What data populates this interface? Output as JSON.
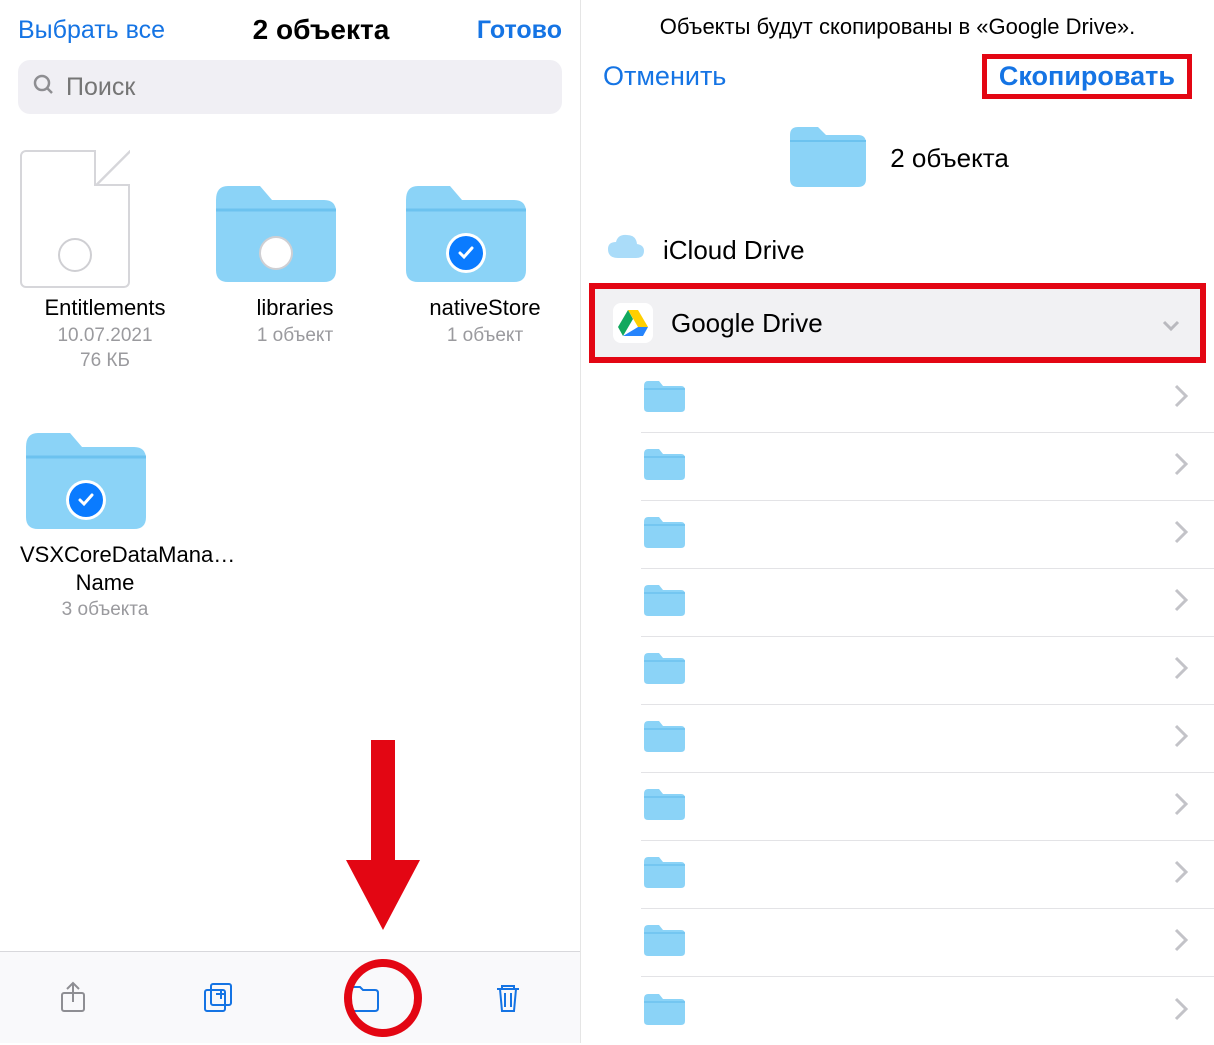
{
  "left": {
    "select_all": "Выбрать все",
    "title": "2 объекта",
    "done": "Готово",
    "search_placeholder": "Поиск",
    "items": [
      {
        "type": "file",
        "name": "Entitlements",
        "meta1": "10.07.2021",
        "meta2": "76 КБ",
        "selected": false
      },
      {
        "type": "folder",
        "name": "libraries",
        "meta1": "1 объект",
        "meta2": "",
        "selected": false,
        "show_circle": true
      },
      {
        "type": "folder",
        "name": "nativeStore",
        "meta1": "1 объект",
        "meta2": "",
        "selected": true
      },
      {
        "type": "folder",
        "name": "VSXCoreDataMana…Name",
        "meta1": "3 объекта",
        "meta2": "",
        "selected": true
      }
    ]
  },
  "right": {
    "caption": "Объекты будут скопированы в «Google Drive».",
    "cancel": "Отменить",
    "copy": "Скопировать",
    "hero_title": "2 объекта",
    "locations": {
      "icloud": "iCloud Drive",
      "google": "Google Drive"
    },
    "sub_count": 10
  }
}
